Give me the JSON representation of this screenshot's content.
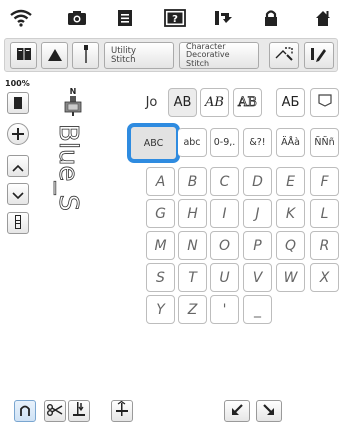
{
  "toolbar": {
    "utility_stitch_label": "Utility\nStitch",
    "character_decorative_label": "Character\nDecorative\nStitch"
  },
  "left_panel": {
    "zoom_level": "100%"
  },
  "preview": {
    "text": "Blue_S"
  },
  "category_keys": [
    "Jo",
    "AB",
    "AB",
    "AB",
    "АБ",
    ""
  ],
  "set_keys": [
    "ABC",
    "abc",
    "0-9,.",
    "&?!",
    "ÄÅà",
    "ÑÑñ"
  ],
  "char_rows": [
    [
      "A",
      "B",
      "C",
      "D",
      "E",
      "F"
    ],
    [
      "G",
      "H",
      "I",
      "J",
      "K",
      "L"
    ],
    [
      "M",
      "N",
      "O",
      "P",
      "Q",
      "R"
    ],
    [
      "S",
      "T",
      "U",
      "V",
      "W",
      "X"
    ],
    [
      "Y",
      "Z",
      "'",
      "_"
    ]
  ],
  "colors": {
    "accent": "#2e8be0",
    "toolbar_bg": "#e9e9e9"
  }
}
